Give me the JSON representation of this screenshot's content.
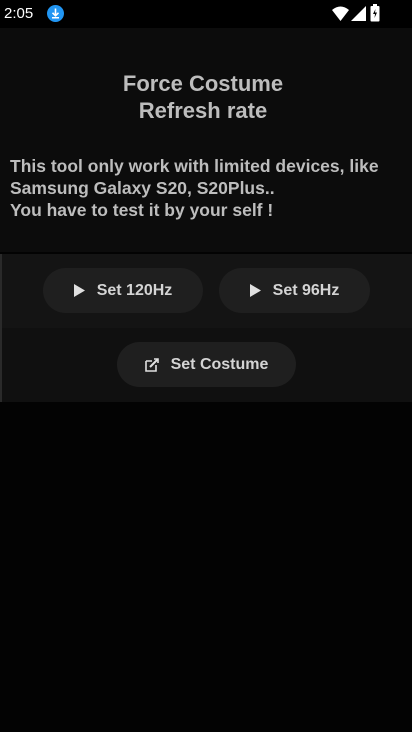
{
  "status_bar": {
    "time": "2:05",
    "icons": [
      "download-icon",
      "wifi-icon",
      "signal-icon",
      "battery-icon"
    ]
  },
  "header": {
    "title": "Force Costume\nRefresh rate",
    "note": "This tool only work with limited devices, like\nSamsung Galaxy S20, S20Plus..\nYou have to test it by your self !"
  },
  "buttons": {
    "set_120": {
      "label": "Set 120Hz",
      "icon": "play-icon"
    },
    "set_96": {
      "label": "Set 96Hz",
      "icon": "play-icon"
    },
    "set_costume": {
      "label": "Set Costume",
      "icon": "edit-icon"
    }
  },
  "colors": {
    "background": "#030303",
    "panel": "#101010",
    "button": "#1f1f1f",
    "text": "#bdbdbd",
    "accent": "#2196f3"
  }
}
